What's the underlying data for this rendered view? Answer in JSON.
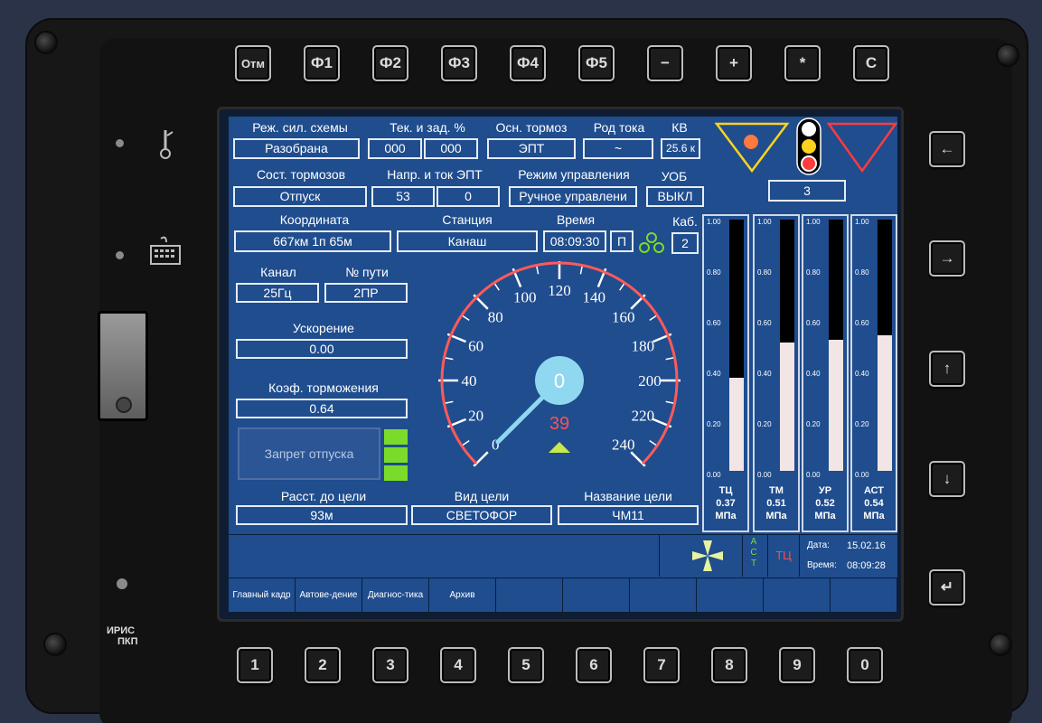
{
  "top_buttons": [
    "Отм",
    "Ф1",
    "Ф2",
    "Ф3",
    "Ф4",
    "Ф5",
    "−",
    "+",
    "*",
    "С"
  ],
  "bottom_buttons": [
    "1",
    "2",
    "3",
    "4",
    "5",
    "6",
    "7",
    "8",
    "9",
    "0"
  ],
  "right_buttons": [
    "←",
    "→",
    "↑",
    "↓",
    "↵"
  ],
  "logo": {
    "line1": "ИРИС",
    "line2": "ПКП"
  },
  "labels": {
    "rezh_sil_skhemy": "Реж. сил. схемы",
    "tek_zad": "Тек.  и зад. %",
    "osn_tormoz": "Осн. тормоз",
    "rod_toka": "Род тока",
    "kv": "КВ",
    "sost_tormozov": "Сост. тормозов",
    "napr_tok_ept": "Напр. и ток ЭПТ",
    "rezhim_upravleniya": "Режим управления",
    "uob": "УОБ",
    "koordinata": "Координата",
    "stantsiya": "Станция",
    "vremya": "Время",
    "kab": "Каб.",
    "kanal": "Канал",
    "nomer_puti": "№ пути",
    "uskorenie": "Ускорение",
    "koef_tormozheniya": "Коэф. торможения",
    "rasst_do_tseli": "Расст. до цели",
    "vid_tseli": "Вид цели",
    "nazvanie_tseli": "Название цели"
  },
  "values": {
    "rezh_sil_skhemy": "Разобрана",
    "tek": "000",
    "zad": "000",
    "osn_tormoz": "ЭПТ",
    "rod_toka": "~",
    "kv": "25.6 к",
    "sost_tormozov": "Отпуск",
    "napr_ept": "53",
    "tok_ept": "0",
    "rezhim_upravleniya": "Ручное управлени",
    "uob": "ВЫКЛ",
    "signal_number": "3",
    "koordinata": "667км 1п 65м",
    "stantsiya": "Канаш",
    "vremya": "08:09:30",
    "p": "П",
    "kab": "2",
    "kanal": "25Гц",
    "nomer_puti": "2ПР",
    "uskorenie": "0.00",
    "koef_tormozheniya": "0.64",
    "zapret_otpuska": "Запрет отпуска",
    "rasst_do_tseli": "93м",
    "vid_tseli": "СВЕТОФОР",
    "nazvanie_tseli": "ЧМ11"
  },
  "speedometer": {
    "current_speed": "0",
    "target_speed": "39",
    "ticks": [
      0,
      20,
      40,
      60,
      80,
      100,
      120,
      140,
      160,
      180,
      200,
      220,
      240
    ],
    "needle_value": 39,
    "max": 240
  },
  "gauges": {
    "ticks": [
      "1.00",
      "0.80",
      "0.60",
      "0.40",
      "0.20",
      "0.00"
    ],
    "items": [
      {
        "name": "ТЦ",
        "value": "0.37",
        "unit": "МПа",
        "level": 0.37
      },
      {
        "name": "ТМ",
        "value": "0.51",
        "unit": "МПа",
        "level": 0.51
      },
      {
        "name": "УР",
        "value": "0.52",
        "unit": "МПа",
        "level": 0.52
      },
      {
        "name": "АСТ",
        "value": "0.54",
        "unit": "МПа",
        "level": 0.54
      }
    ]
  },
  "status": {
    "ast_vertical": "АСТ",
    "tc": "ТЦ",
    "date_label": "Дата:",
    "date": "15.02.16",
    "time_label": "Время:",
    "time": "08:09:28"
  },
  "menu": [
    "Главный кадр",
    "Автове-дение",
    "Диагнос-тика",
    "Архив",
    "",
    "",
    "",
    "",
    "",
    ""
  ],
  "colors": {
    "screen_bg": "#1f4d8e",
    "needle": "#8fd8f0",
    "arc_red": "#ff5a5a",
    "green": "#7bdb2a",
    "target_speed": "#ff5050"
  }
}
